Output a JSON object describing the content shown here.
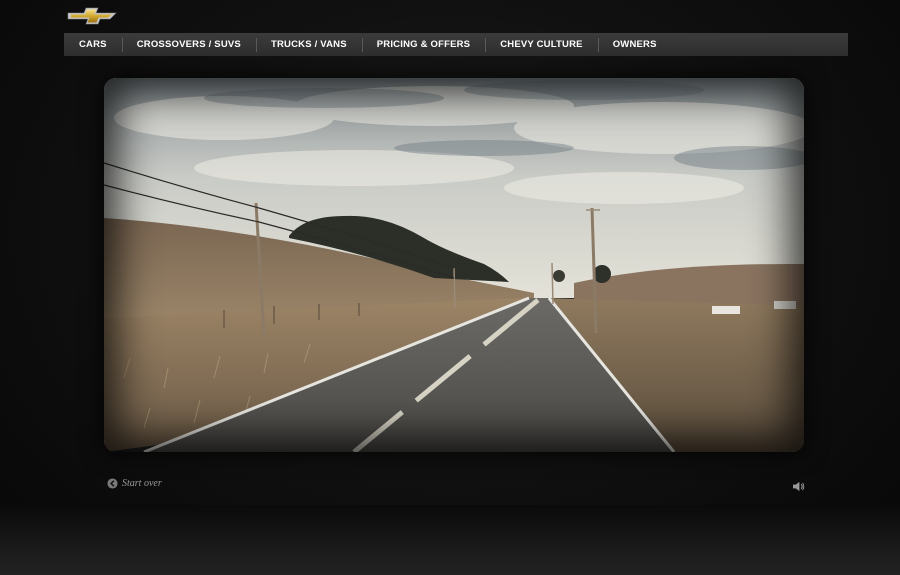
{
  "brand": {
    "logo_icon": "chevy-bowtie-icon",
    "logo_color": "#d9b648"
  },
  "nav": {
    "items": [
      {
        "label": "CARS"
      },
      {
        "label": "CROSSOVERS / SUVS"
      },
      {
        "label": "TRUCKS / VANS"
      },
      {
        "label": "PRICING & OFFERS"
      },
      {
        "label": "CHEVY CULTURE"
      },
      {
        "label": "OWNERS"
      }
    ]
  },
  "video": {
    "scene": "country-road-video-frame"
  },
  "controls": {
    "start_over_label": "Start over",
    "start_over_icon": "back-arrow-circle-icon",
    "sound_icon": "speaker-icon"
  }
}
